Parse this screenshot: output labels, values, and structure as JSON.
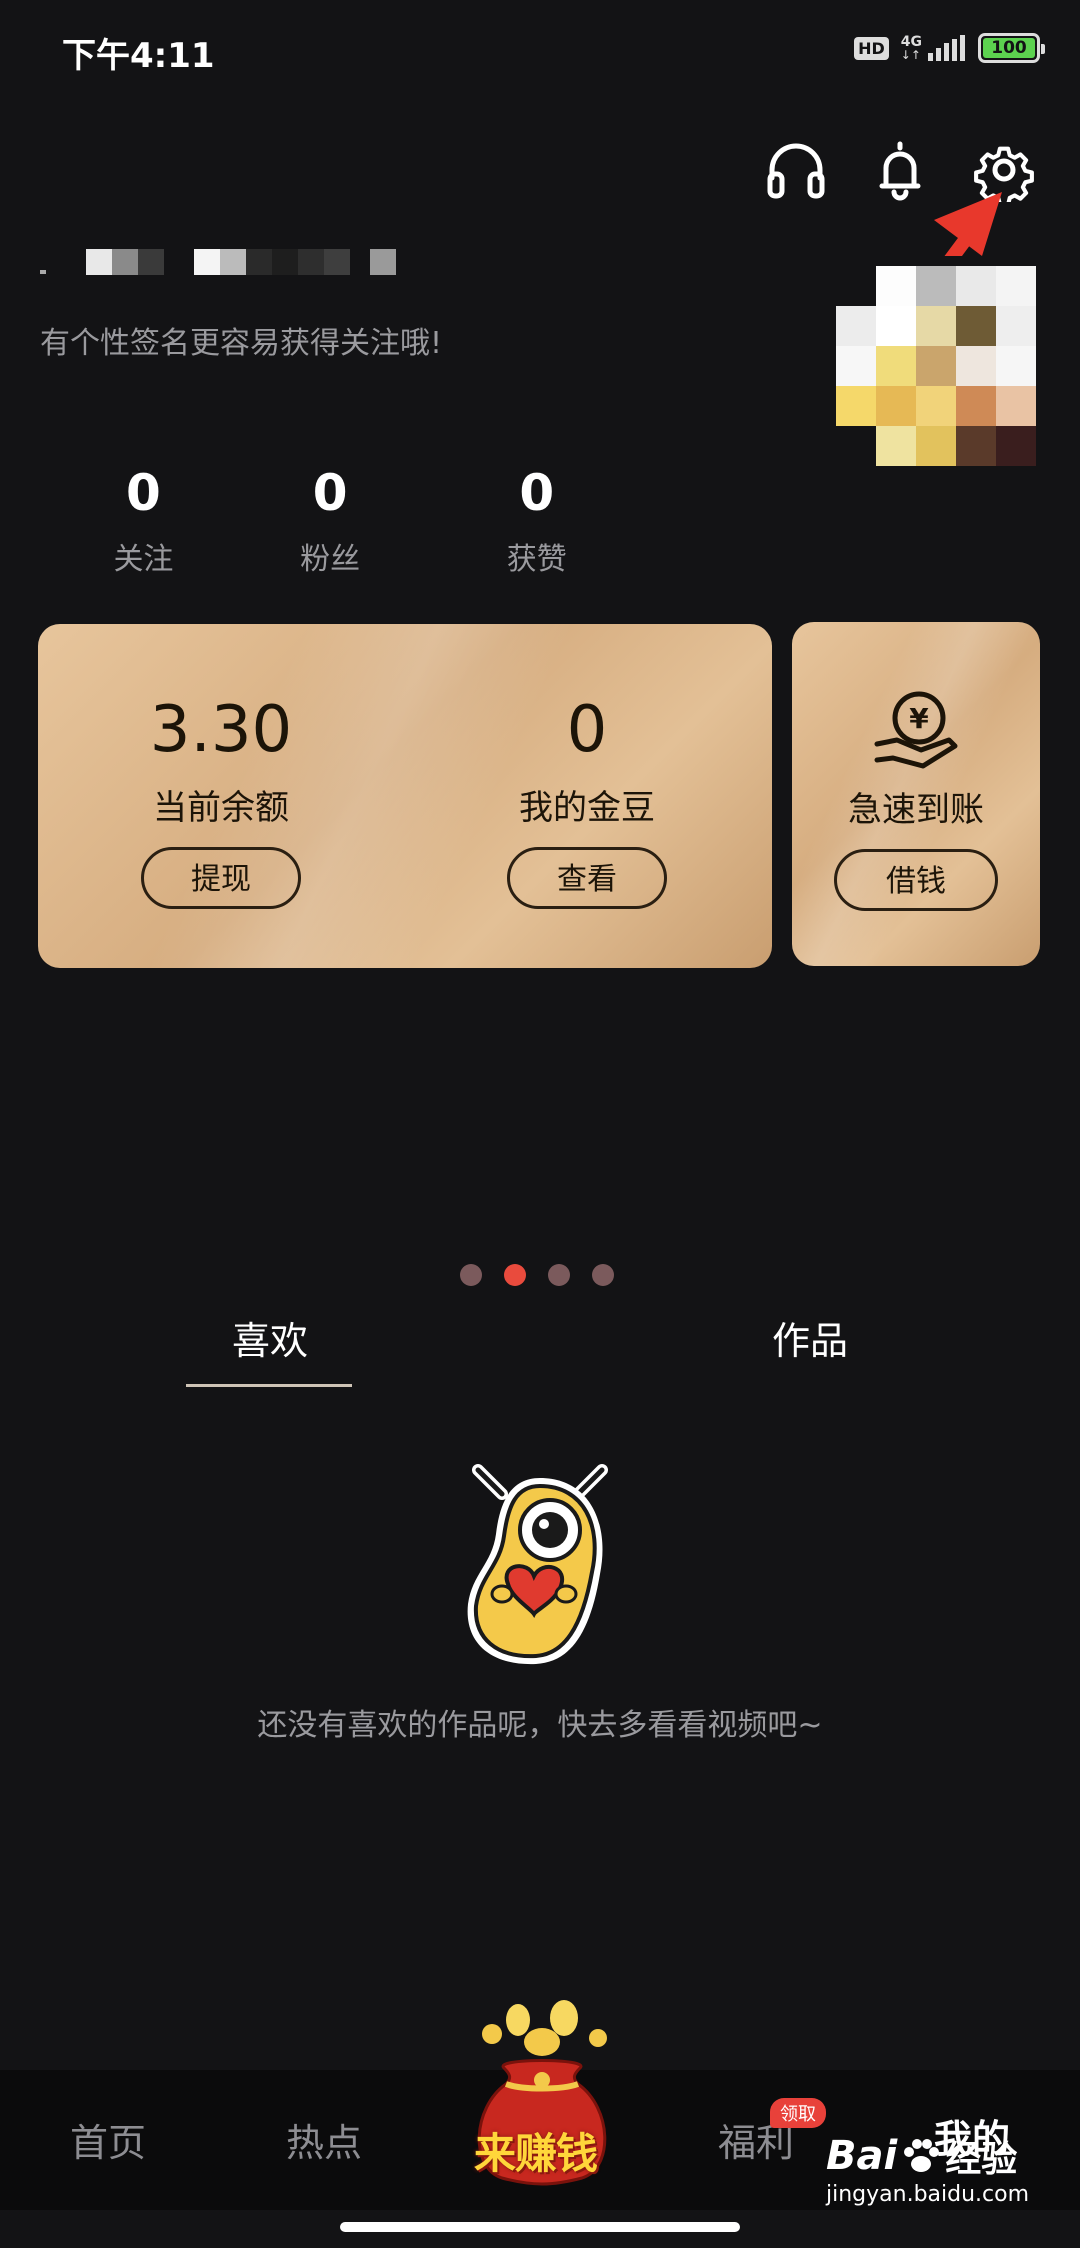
{
  "status_bar": {
    "time": "下午4:11",
    "hd": "HD",
    "network": "4G",
    "battery": "100",
    "battery_level": 1.0
  },
  "header_icons": [
    "headphones-icon",
    "bell-icon",
    "settings-icon"
  ],
  "profile": {
    "bio": "有个性签名更容易获得关注哦!"
  },
  "stats": [
    {
      "value": "0",
      "label": "关注"
    },
    {
      "value": "0",
      "label": "粉丝"
    },
    {
      "value": "0",
      "label": "获赞"
    }
  ],
  "wallet_card": {
    "balance": {
      "value": "3.30",
      "label": "当前余额",
      "button": "提现"
    },
    "beans": {
      "value": "0",
      "label": "我的金豆",
      "button": "查看"
    }
  },
  "loan_card": {
    "label": "急速到账",
    "button": "借钱",
    "icon": "yen-hand-icon"
  },
  "carousel": {
    "total": 4,
    "active": 2
  },
  "tabs": [
    {
      "label": "喜欢",
      "selected": true
    },
    {
      "label": "作品",
      "selected": false
    }
  ],
  "empty_state": {
    "text": "还没有喜欢的作品呢，快去多看看视频吧~"
  },
  "bottom_nav": {
    "items": [
      {
        "label": "首页"
      },
      {
        "label": "热点"
      },
      {
        "label": "来赚钱"
      },
      {
        "label": "福利",
        "badge": "领取"
      },
      {
        "label": "我的"
      }
    ],
    "active_index": 4
  },
  "watermark": {
    "brand": "Bai",
    "brand2": "经验",
    "url": "jingyan.baidu.com"
  },
  "colors": {
    "background": "#131315",
    "accent_red": "#e94b3d",
    "card_gold": "#ddb88a"
  }
}
